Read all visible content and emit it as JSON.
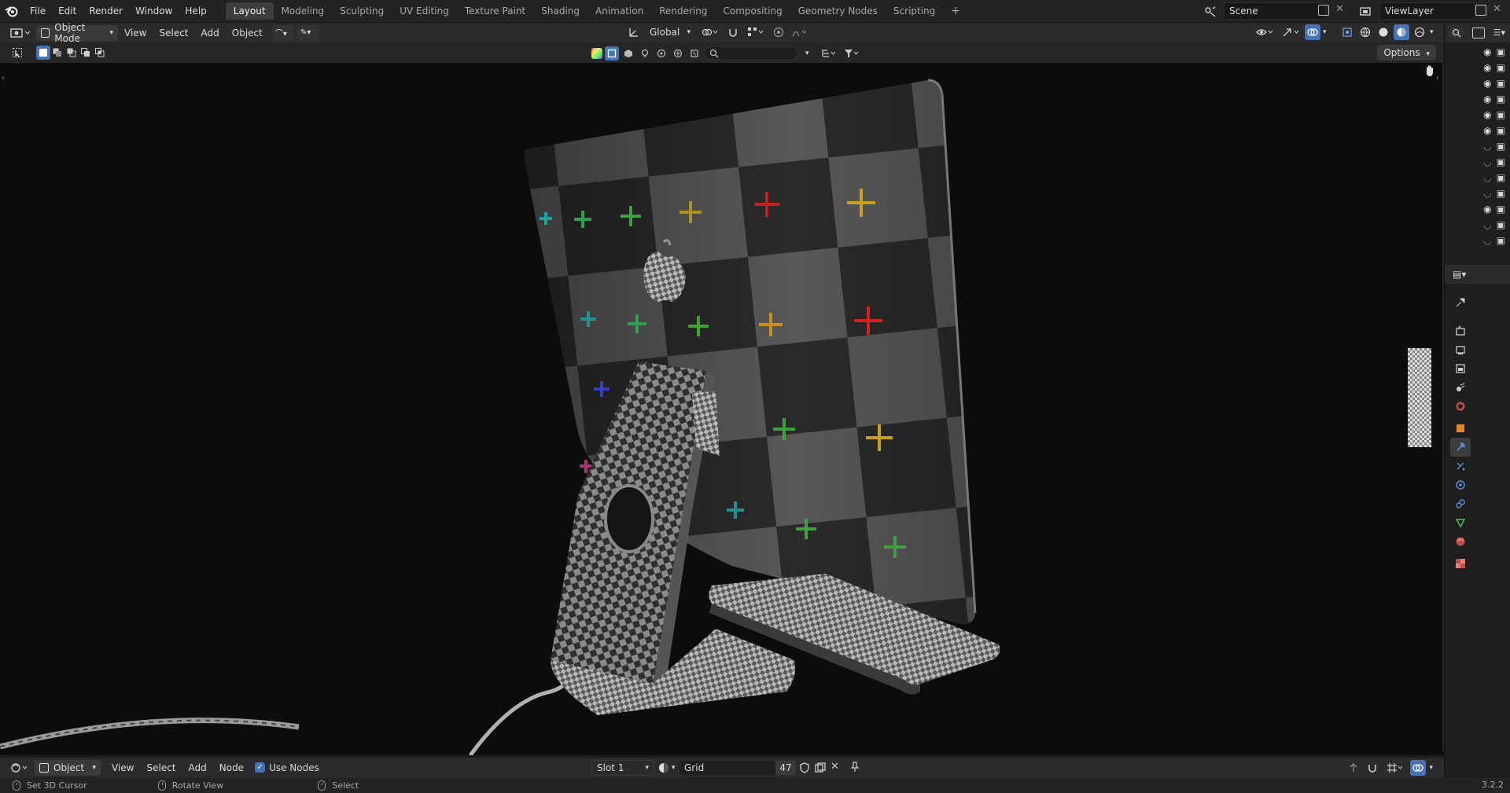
{
  "topbar": {
    "menus": [
      "File",
      "Edit",
      "Render",
      "Window",
      "Help"
    ],
    "workspaces": [
      "Layout",
      "Modeling",
      "Sculpting",
      "UV Editing",
      "Texture Paint",
      "Shading",
      "Animation",
      "Rendering",
      "Compositing",
      "Geometry Nodes",
      "Scripting"
    ],
    "active_workspace": "Layout",
    "add_tab": "+",
    "scene_name": "Scene",
    "view_layer_name": "ViewLayer"
  },
  "viewport_header": {
    "mode": "Object Mode",
    "menus": [
      "View",
      "Select",
      "Add",
      "Object"
    ],
    "transform_orientation": "Global",
    "options_label": "Options"
  },
  "bottom_header": {
    "editor_mode": "Object",
    "menus": [
      "View",
      "Select",
      "Add",
      "Node"
    ],
    "use_nodes_label": "Use Nodes",
    "use_nodes_checked": true,
    "slot_label": "Slot 1",
    "material_name": "Grid",
    "user_count": "47"
  },
  "statusbar": {
    "left_action": "Set 3D Cursor",
    "middle_action": "Rotate View",
    "right_action": "Select",
    "version": "3.2.2"
  },
  "colors": {
    "accent": "#4772b3",
    "bg": "#1d1d1d",
    "viewport_bg": "#0c0c0c"
  }
}
